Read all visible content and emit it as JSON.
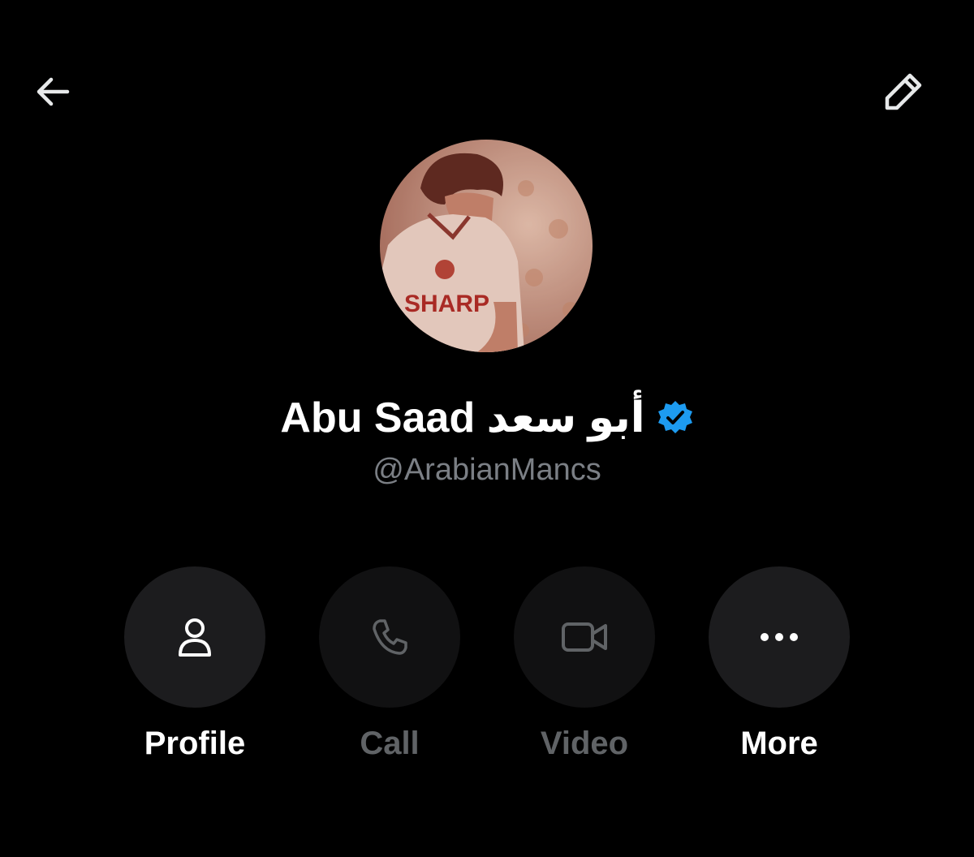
{
  "header": {
    "back_icon": "arrow-left-icon",
    "edit_icon": "pencil-icon"
  },
  "profile": {
    "name": "Abu Saad أبو سعد",
    "handle": "@ArabianMancs",
    "verified": true,
    "avatar_caption": "SHARP",
    "colors": {
      "verified_badge": "#1d9bf0",
      "handle": "#7b7f85"
    }
  },
  "actions": [
    {
      "label": "Profile",
      "icon": "person-icon",
      "enabled": true
    },
    {
      "label": "Call",
      "icon": "phone-icon",
      "enabled": false
    },
    {
      "label": "Video",
      "icon": "video-camera-icon",
      "enabled": false
    },
    {
      "label": "More",
      "icon": "more-dots-icon",
      "enabled": true
    }
  ]
}
